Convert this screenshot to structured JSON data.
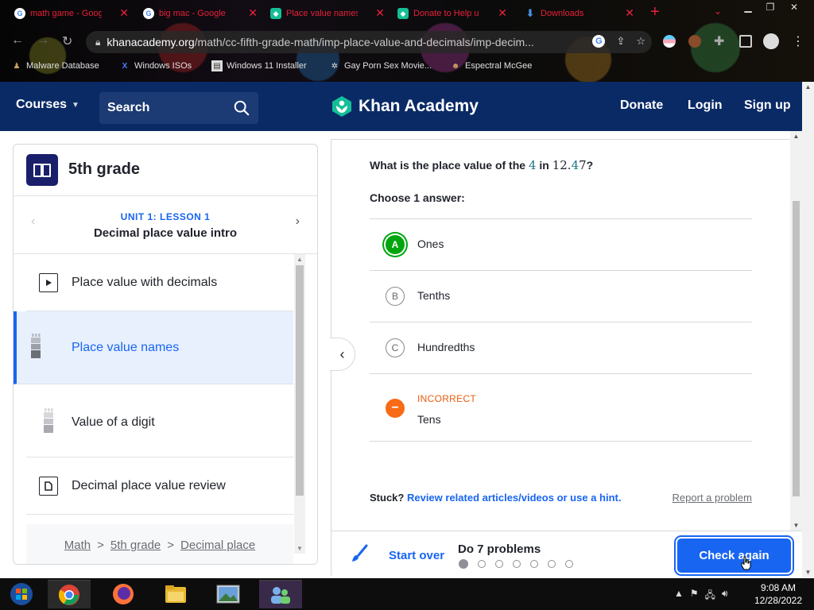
{
  "browser": {
    "tabs": [
      {
        "title": "math game - Goog",
        "favicon": "google-icon"
      },
      {
        "title": "big mac - Google",
        "favicon": "google-icon"
      },
      {
        "title": "Place value names",
        "favicon": "khan-academy-icon"
      },
      {
        "title": "Donate to Help u",
        "favicon": "khan-academy-icon"
      },
      {
        "title": "Downloads",
        "favicon": "download-icon"
      }
    ],
    "url_host": "khanacademy.org",
    "url_path": "/math/cc-fifth-grade-math/imp-place-value-and-decimals/imp-decim...",
    "bookmarks": [
      "Malware Database",
      "Windows ISOs",
      "Windows 11 Installer",
      "Gay Porn Sex Movie...",
      "Espectral McGee"
    ]
  },
  "header": {
    "courses": "Courses",
    "search": "Search",
    "brand": "Khan Academy",
    "donate": "Donate",
    "login": "Login",
    "signup": "Sign up",
    "colors": {
      "bg": "#0a2a66",
      "brand_green": "#14bf96"
    }
  },
  "sidebar": {
    "grade": "5th grade",
    "unit": "UNIT 1: LESSON 1",
    "lesson": "Decimal place value intro",
    "items": [
      {
        "label": "Place value with decimals",
        "icon": "play-icon"
      },
      {
        "label": "Place value names",
        "icon": "exercise-tower-icon",
        "active": true
      },
      {
        "label": "Value of a digit",
        "icon": "exercise-tower-icon"
      },
      {
        "label": "Decimal place value review",
        "icon": "article-icon"
      }
    ],
    "breadcrumb": [
      "Math",
      "5th grade",
      "Decimal place"
    ]
  },
  "exercise": {
    "question_prefix": "What is the place value of the",
    "digit": "4",
    "question_mid": "in",
    "number_before": "12.",
    "number_digit": "4",
    "number_after": "7",
    "question_suffix": "?",
    "choose": "Choose 1 answer:",
    "choices": [
      {
        "letter": "A",
        "text": "Ones",
        "state": "selected"
      },
      {
        "letter": "B",
        "text": "Tenths",
        "state": "none"
      },
      {
        "letter": "C",
        "text": "Hundredths",
        "state": "none"
      },
      {
        "letter": "−",
        "text": "Tens",
        "state": "incorrect",
        "status": "INCORRECT"
      }
    ],
    "stuck": "Stuck?",
    "hint": "Review related articles/videos or use a hint.",
    "report": "Report a problem"
  },
  "footer": {
    "start_over": "Start over",
    "do_problems": "Do 7 problems",
    "problem_count": 7,
    "current_problem": 1,
    "check": "Check again",
    "accent": "#1865f2"
  },
  "taskbar": {
    "time": "9:08 AM",
    "date": "12/28/2022"
  }
}
